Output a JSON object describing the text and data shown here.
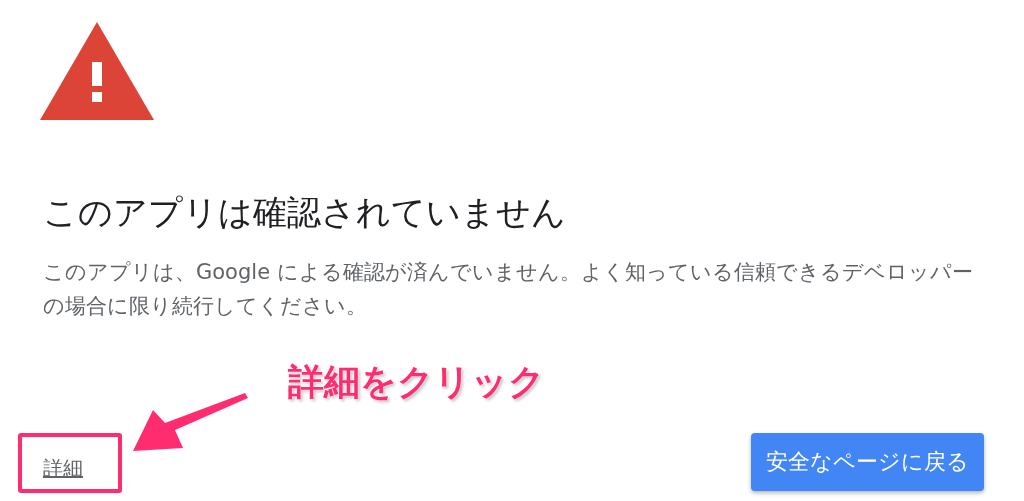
{
  "title": "このアプリは確認されていません",
  "message": "このアプリは、Google による確認が済んでいません。よく知っている信頼できるデベロッパーの場合に限り続行してください。",
  "details_link": "詳細",
  "back_button": "安全なページに戻る",
  "annotation": {
    "text": "詳細をクリック",
    "color": "#ff2d6f"
  }
}
